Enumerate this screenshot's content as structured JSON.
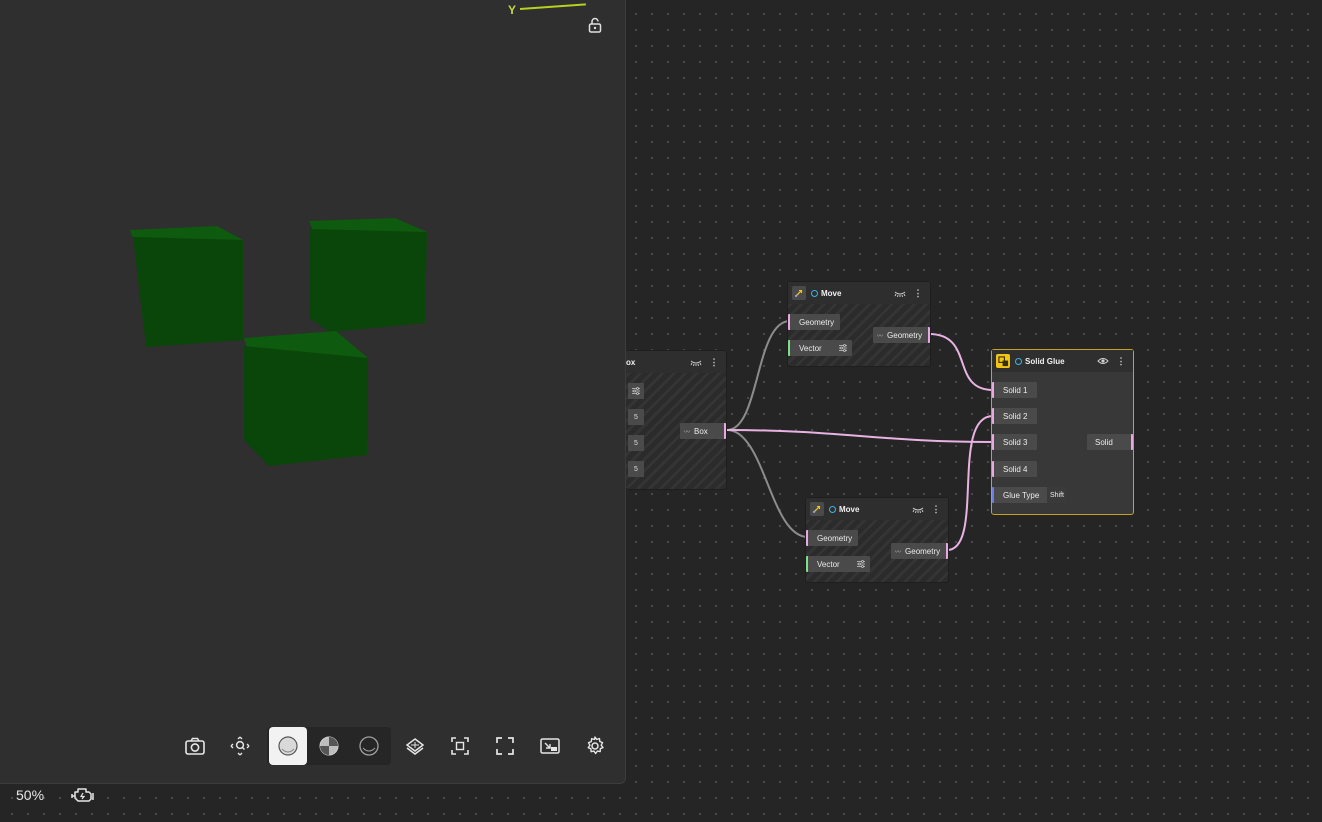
{
  "viewport": {
    "axis_label": "Y",
    "cube_color": "#0b4a0b",
    "toolbar": {
      "buttons": [
        "camera-icon",
        "zoom-fit-icon",
        "shading-solid-icon",
        "shading-mixed-icon",
        "shading-wire-icon",
        "plane-icon",
        "frame-selection-icon",
        "fullscreen-icon",
        "picture-in-picture-icon",
        "settings-icon"
      ],
      "active_shading": "shading-solid-icon"
    },
    "zoom": "50%"
  },
  "nodes": {
    "box": {
      "title": "ox",
      "param_values": [
        "5",
        "5",
        "5"
      ],
      "output": "Box"
    },
    "move_top": {
      "title": "Move",
      "inputs": [
        "Geometry",
        "Vector"
      ],
      "output": "Geometry"
    },
    "move_bottom": {
      "title": "Move",
      "inputs": [
        "Geometry",
        "Vector"
      ],
      "output": "Geometry"
    },
    "solid_glue": {
      "title": "Solid Glue",
      "inputs": [
        "Solid 1",
        "Solid 2",
        "Solid 3",
        "Solid 4"
      ],
      "glue_type_label": "Glue Type",
      "glue_type_value": "Shift",
      "output": "Solid"
    }
  },
  "colors": {
    "geometry_wire": "#e9b2e3",
    "generic_wire": "#8c8c8c",
    "glue_border": "#c9a21f",
    "glue_icon": "#f2c515",
    "status_ring": "#3ab4e8"
  }
}
